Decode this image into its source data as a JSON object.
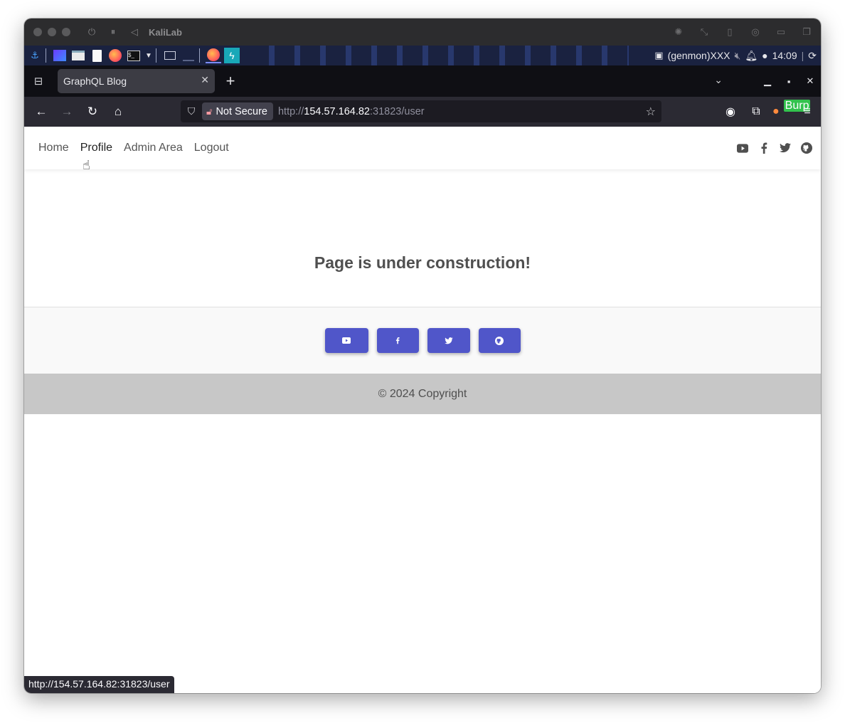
{
  "vm": {
    "title": "KaliLab"
  },
  "kali_panel": {
    "genmon": "(genmon)XXX",
    "clock": "14:09"
  },
  "tab": {
    "title": "GraphQL Blog"
  },
  "urlbar": {
    "security_label": "Not Secure",
    "scheme": "http://",
    "host": "154.57.164.82",
    "rest": ":31823/user"
  },
  "toolbar": {
    "burp_badge": "Burp"
  },
  "site": {
    "nav": [
      "Home",
      "Profile",
      "Admin Area",
      "Logout"
    ],
    "heading": "Page is under construction!",
    "copyright": "© 2024 Copyright"
  },
  "status_bar": {
    "link": "http://154.57.164.82:31823/user"
  },
  "colors": {
    "accent": "#5056c9",
    "footer_bg": "#c7c7c7"
  },
  "icons": {
    "social": [
      "youtube-icon",
      "facebook-icon",
      "twitter-icon",
      "github-icon"
    ]
  }
}
